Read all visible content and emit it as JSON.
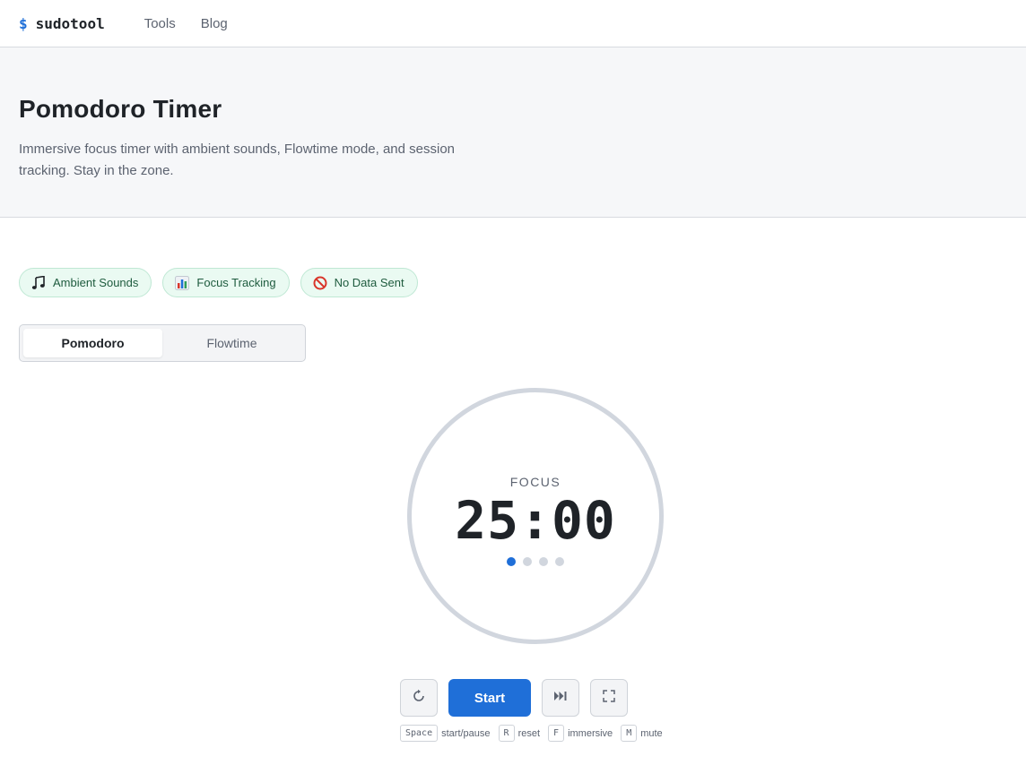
{
  "nav": {
    "logo_prefix": "$",
    "logo_text": "sudotool",
    "links": [
      "Tools",
      "Blog"
    ]
  },
  "hero": {
    "title": "Pomodoro Timer",
    "description": "Immersive focus timer with ambient sounds, Flowtime mode, and session tracking. Stay in the zone."
  },
  "badges": [
    {
      "icon": "music-note-icon",
      "label": "Ambient Sounds"
    },
    {
      "icon": "bar-chart-icon",
      "label": "Focus Tracking"
    },
    {
      "icon": "no-entry-icon",
      "label": "No Data Sent"
    }
  ],
  "modes": {
    "tabs": [
      "Pomodoro",
      "Flowtime"
    ],
    "active": "Pomodoro"
  },
  "timer": {
    "phase": "FOCUS",
    "time": "25:00",
    "sessions_total": 4,
    "sessions_current": 1
  },
  "controls": {
    "reset_icon": "reset-icon",
    "start_label": "Start",
    "skip_icon": "skip-icon",
    "fullscreen_icon": "fullscreen-icon"
  },
  "shortcuts": [
    {
      "key": "Space",
      "desc": "start/pause"
    },
    {
      "key": "R",
      "desc": "reset"
    },
    {
      "key": "F",
      "desc": "immersive"
    },
    {
      "key": "M",
      "desc": "mute"
    }
  ],
  "colors": {
    "accent": "#1f6fd8",
    "badge_bg": "#eafaf2",
    "badge_text": "#1e5b3e",
    "ring": "#d1d6de"
  }
}
